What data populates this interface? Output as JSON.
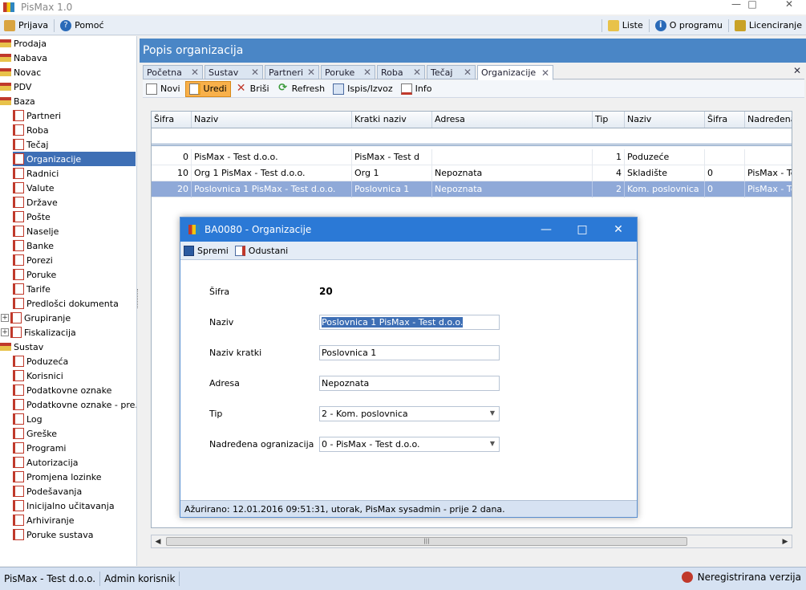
{
  "app": {
    "title": "PisMax 1.0"
  },
  "menubar": {
    "left": [
      "Prijava",
      "Pomoć"
    ],
    "right": [
      "Liste",
      "O programu",
      "Licenciranje"
    ]
  },
  "sidebar": {
    "items": [
      {
        "label": "Prodaja",
        "level": 0,
        "type": "root"
      },
      {
        "label": "Nabava",
        "level": 0,
        "type": "root"
      },
      {
        "label": "Novac",
        "level": 0,
        "type": "root"
      },
      {
        "label": "PDV",
        "level": 0,
        "type": "root"
      },
      {
        "label": "Baza",
        "level": 0,
        "type": "root"
      },
      {
        "label": "Partneri",
        "level": 1,
        "type": "doc"
      },
      {
        "label": "Roba",
        "level": 1,
        "type": "doc"
      },
      {
        "label": "Tečaj",
        "level": 1,
        "type": "doc"
      },
      {
        "label": "Organizacije",
        "level": 1,
        "type": "doc",
        "selected": true
      },
      {
        "label": "Radnici",
        "level": 1,
        "type": "doc"
      },
      {
        "label": "Valute",
        "level": 1,
        "type": "doc"
      },
      {
        "label": "Države",
        "level": 1,
        "type": "doc"
      },
      {
        "label": "Pošte",
        "level": 1,
        "type": "doc"
      },
      {
        "label": "Naselje",
        "level": 1,
        "type": "doc"
      },
      {
        "label": "Banke",
        "level": 1,
        "type": "doc"
      },
      {
        "label": "Porezi",
        "level": 1,
        "type": "doc"
      },
      {
        "label": "Poruke",
        "level": 1,
        "type": "doc"
      },
      {
        "label": "Tarife",
        "level": 1,
        "type": "doc"
      },
      {
        "label": "Predlošci dokumenta",
        "level": 1,
        "type": "doc"
      },
      {
        "label": "Grupiranje",
        "level": 1,
        "type": "doc",
        "expander": "+"
      },
      {
        "label": "Fiskalizacija",
        "level": 1,
        "type": "doc",
        "expander": "+"
      },
      {
        "label": "Sustav",
        "level": 0,
        "type": "root"
      },
      {
        "label": "Poduzeća",
        "level": 1,
        "type": "doc"
      },
      {
        "label": "Korisnici",
        "level": 1,
        "type": "doc"
      },
      {
        "label": "Podatkovne oznake",
        "level": 1,
        "type": "doc"
      },
      {
        "label": "Podatkovne oznake - pre...",
        "level": 1,
        "type": "doc"
      },
      {
        "label": "Log",
        "level": 1,
        "type": "doc"
      },
      {
        "label": "Greške",
        "level": 1,
        "type": "doc"
      },
      {
        "label": "Programi",
        "level": 1,
        "type": "doc"
      },
      {
        "label": "Autorizacija",
        "level": 1,
        "type": "doc"
      },
      {
        "label": "Promjena lozinke",
        "level": 1,
        "type": "doc"
      },
      {
        "label": "Podešavanja",
        "level": 1,
        "type": "doc"
      },
      {
        "label": "Inicijalno učitavanja",
        "level": 1,
        "type": "doc"
      },
      {
        "label": "Arhiviranje",
        "level": 1,
        "type": "doc"
      },
      {
        "label": "Poruke sustava",
        "level": 1,
        "type": "doc"
      }
    ]
  },
  "main": {
    "title": "Popis organizacija",
    "tabs": [
      {
        "label": "Početna"
      },
      {
        "label": "Sustav"
      },
      {
        "label": "Partneri"
      },
      {
        "label": "Poruke"
      },
      {
        "label": "Roba"
      },
      {
        "label": "Tečaj"
      },
      {
        "label": "Organizacije",
        "active": true
      }
    ],
    "toolbar": [
      "Novi",
      "Uredi",
      "Briši",
      "Refresh",
      "Ispis/Izvoz",
      "Info"
    ],
    "grid": {
      "columns": [
        "Šifra",
        "Naziv",
        "Kratki naziv",
        "Adresa",
        "Tip",
        "Naziv",
        "Šifra",
        "Nadređena"
      ],
      "rows": [
        [
          "0",
          "PisMax - Test d.o.o.",
          "PisMax - Test d",
          "",
          "1",
          "Poduzeće",
          "",
          ""
        ],
        [
          "10",
          "Org 1 PisMax - Test d.o.o.",
          "Org 1",
          "Nepoznata",
          "4",
          "Skladište",
          "0",
          "PisMax - Tes"
        ],
        [
          "20",
          "Poslovnica 1 PisMax - Test d.o.o.",
          "Poslovnica 1",
          "Nepoznata",
          "2",
          "Kom. poslovnica",
          "0",
          "PisMax - Tes"
        ]
      ],
      "selected_row": 2
    }
  },
  "statusbar": {
    "company": "PisMax - Test d.o.o.",
    "user": "Admin korisnik",
    "license": "Neregistrirana verzija"
  },
  "dialog": {
    "title": "BA0080 - Organizacije",
    "toolbar": {
      "save": "Spremi",
      "cancel": "Odustani"
    },
    "fields": {
      "sifra_label": "Šifra",
      "sifra_value": "20",
      "naziv_label": "Naziv",
      "naziv_value": "Poslovnica 1 PisMax - Test d.o.o.",
      "kratki_label": "Naziv kratki",
      "kratki_value": "Poslovnica 1",
      "adresa_label": "Adresa",
      "adresa_value": "Nepoznata",
      "tip_label": "Tip",
      "tip_value": "2 - Kom. poslovnica",
      "nadr_label": "Nadređena ogranizacija",
      "nadr_value": "0 - PisMax - Test d.o.o."
    },
    "status": "Ažurirano: 12.01.2016 09:51:31, utorak, PisMax sysadmin -  prije 2 dana."
  }
}
